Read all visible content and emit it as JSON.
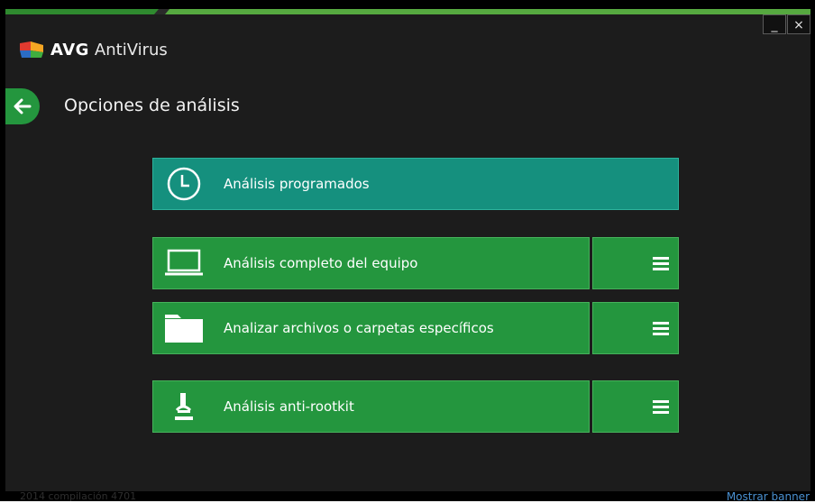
{
  "app": {
    "brand_bold": "AVG",
    "brand_product": "AntiVirus",
    "window_min": "_",
    "window_close": "×"
  },
  "page": {
    "title": "Opciones de análisis"
  },
  "scans": {
    "scheduled": {
      "label": "Análisis programados",
      "icon": "clock-icon",
      "color": "#15907e"
    },
    "full": {
      "label": "Análisis completo del equipo",
      "icon": "laptop-icon",
      "color": "#24963e"
    },
    "files": {
      "label": "Analizar archivos o carpetas específicos",
      "icon": "folder-icon",
      "color": "#24963e"
    },
    "rootkit": {
      "label": "Análisis anti-rootkit",
      "icon": "microscope-icon",
      "color": "#24963e"
    }
  },
  "footer": {
    "version": "2014 compilación 4701",
    "show_banner": "Mostrar banner"
  }
}
